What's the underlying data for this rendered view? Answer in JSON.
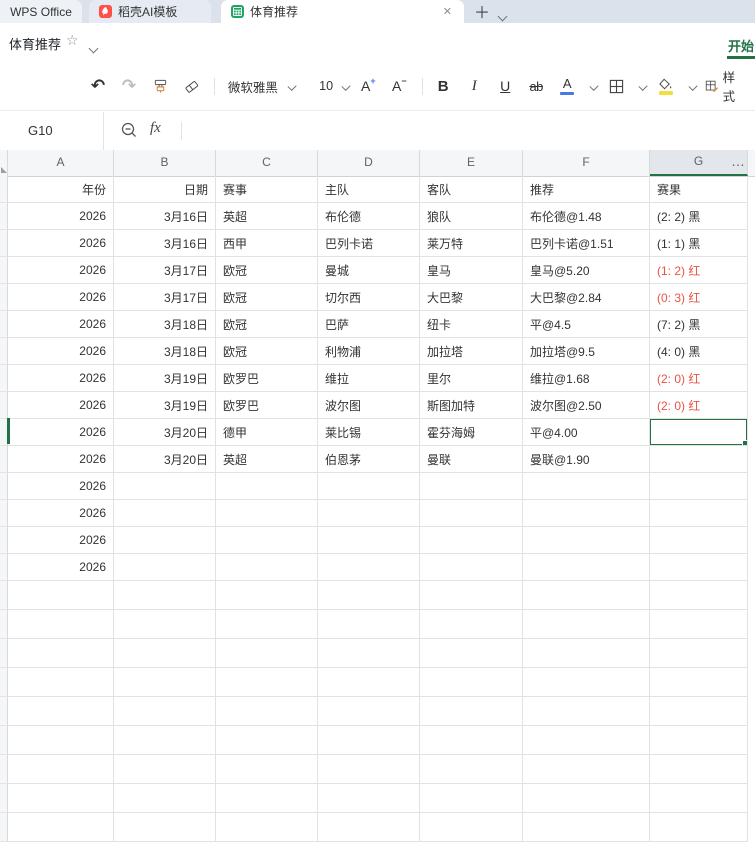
{
  "window": {
    "tabs": [
      {
        "label": "WPS Office"
      },
      {
        "label": "稻壳AI模板",
        "icon": "docer-icon"
      },
      {
        "label": "体育推荐",
        "icon": "spreadsheet-icon",
        "active": true,
        "close": "✕"
      }
    ],
    "new_tab_label": "＋"
  },
  "titlebar": {
    "doc_title": "体育推荐",
    "star_icon": "☆",
    "ribbon_tab": "开始"
  },
  "toolbar": {
    "undo": "↶",
    "redo": "↷",
    "font_name": "微软雅黑",
    "font_size": "10",
    "grow_font": "A",
    "grow_font_sign": "+",
    "shrink_font": "A",
    "shrink_font_sign": "−",
    "bold": "B",
    "italic": "I",
    "underline": "U",
    "strikethrough": "ab",
    "font_color_letter": "A",
    "styles_label": "样式"
  },
  "formula_bar": {
    "name_box": "G10",
    "fx_label": "fx"
  },
  "colors": {
    "accent_green": "#217346",
    "sheet_icon_green": "#21a366",
    "docer_icon_red": "#ff5148",
    "result_red": "#eb5245",
    "font_color_bar_blue": "#4779e0",
    "fill_color_bar_yellow": "#f2df3a"
  },
  "sheet": {
    "column_headers": [
      "A",
      "B",
      "C",
      "D",
      "E",
      "F",
      "G"
    ],
    "active_column": "G",
    "more_button": "…",
    "selected_cell": "G10",
    "header_row": [
      "年份",
      "日期",
      "赛事",
      "主队",
      "客队",
      "推荐",
      "赛果"
    ],
    "rows": [
      {
        "cells": [
          "2026",
          "3月16日",
          "英超",
          "布伦德",
          "狼队",
          "布伦德@1.48",
          "(2: 2) 黑"
        ],
        "result_red": false
      },
      {
        "cells": [
          "2026",
          "3月16日",
          "西甲",
          "巴列卡诺",
          "莱万特",
          "巴列卡诺@1.51",
          "(1: 1) 黑"
        ],
        "result_red": false
      },
      {
        "cells": [
          "2026",
          "3月17日",
          "欧冠",
          "曼城",
          "皇马",
          "皇马@5.20",
          "(1: 2) 红"
        ],
        "result_red": true
      },
      {
        "cells": [
          "2026",
          "3月17日",
          "欧冠",
          "切尔西",
          "大巴黎",
          "大巴黎@2.84",
          "(0: 3) 红"
        ],
        "result_red": true
      },
      {
        "cells": [
          "2026",
          "3月18日",
          "欧冠",
          "巴萨",
          "纽卡",
          "平@4.5",
          "(7: 2) 黑"
        ],
        "result_red": false
      },
      {
        "cells": [
          "2026",
          "3月18日",
          "欧冠",
          "利物浦",
          "加拉塔",
          "加拉塔@9.5",
          "(4: 0) 黑"
        ],
        "result_red": false
      },
      {
        "cells": [
          "2026",
          "3月19日",
          "欧罗巴",
          "维拉",
          "里尔",
          "维拉@1.68",
          "(2: 0) 红"
        ],
        "result_red": true
      },
      {
        "cells": [
          "2026",
          "3月19日",
          "欧罗巴",
          "波尔图",
          "斯图加特",
          "波尔图@2.50",
          "(2: 0) 红"
        ],
        "result_red": true
      },
      {
        "cells": [
          "2026",
          "3月20日",
          "德甲",
          "莱比锡",
          "霍芬海姆",
          "平@4.00",
          ""
        ],
        "result_red": false
      },
      {
        "cells": [
          "2026",
          "3月20日",
          "英超",
          "伯恩茅",
          "曼联",
          "曼联@1.90",
          ""
        ],
        "result_red": false
      },
      {
        "cells": [
          "2026",
          "",
          "",
          "",
          "",
          "",
          ""
        ],
        "result_red": false
      },
      {
        "cells": [
          "2026",
          "",
          "",
          "",
          "",
          "",
          ""
        ],
        "result_red": false
      },
      {
        "cells": [
          "2026",
          "",
          "",
          "",
          "",
          "",
          ""
        ],
        "result_red": false
      },
      {
        "cells": [
          "2026",
          "",
          "",
          "",
          "",
          "",
          ""
        ],
        "result_red": false
      }
    ]
  }
}
